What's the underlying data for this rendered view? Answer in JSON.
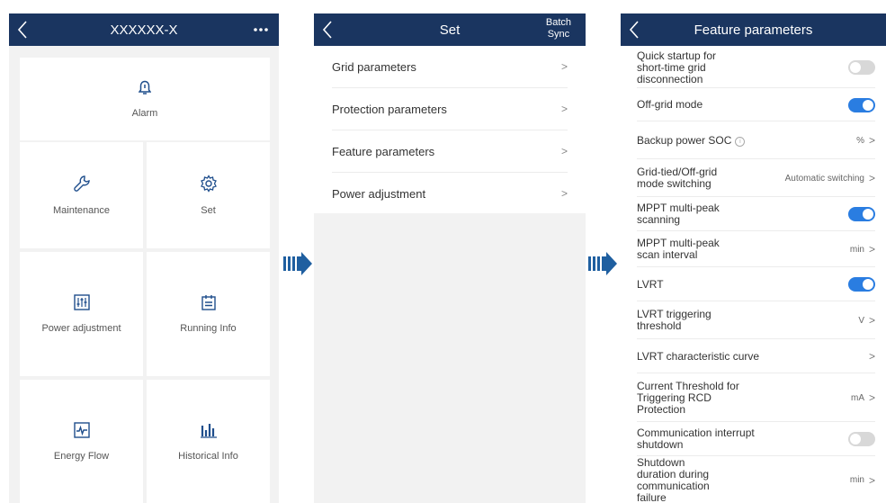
{
  "colors": {
    "header": "#1a3560",
    "toggle_on": "#2a7de1",
    "toggle_off": "#d8d8d8",
    "icon": "#1f4e8c",
    "arrow": "#1f5fa0"
  },
  "screen1": {
    "title": "XXXXXX-X",
    "menu_icon": "more-dots-icon",
    "tiles": [
      {
        "label": "Alarm",
        "icon": "bell-icon"
      },
      {
        "label": "Maintenance",
        "icon": "wrench-icon"
      },
      {
        "label": "Set",
        "icon": "gear-icon"
      },
      {
        "label": "Power adjustment",
        "icon": "sliders-icon"
      },
      {
        "label": "Running Info",
        "icon": "calendar-icon"
      },
      {
        "label": "Energy Flow",
        "icon": "pulse-icon"
      },
      {
        "label": "Historical Info",
        "icon": "bar-chart-icon"
      }
    ]
  },
  "screen2": {
    "title": "Set",
    "batch_line1": "Batch",
    "batch_line2": "Sync",
    "items": [
      {
        "label": "Grid parameters"
      },
      {
        "label": "Protection parameters"
      },
      {
        "label": "Feature parameters"
      },
      {
        "label": "Power adjustment"
      }
    ]
  },
  "screen3": {
    "title": "Feature parameters",
    "items": [
      {
        "label": "Quick startup for short-time grid disconnection",
        "toggle": "off"
      },
      {
        "label": "Off-grid mode",
        "toggle": "on"
      },
      {
        "label": "Backup power SOC",
        "value": "%",
        "info": "i"
      },
      {
        "label": "Grid-tied/Off-grid mode switching",
        "value": "Automatic switching"
      },
      {
        "label": "MPPT multi-peak scanning",
        "toggle": "on"
      },
      {
        "label": "MPPT multi-peak scan interval",
        "value": "min"
      },
      {
        "label": "LVRT",
        "toggle": "on"
      },
      {
        "label": "LVRT triggering threshold",
        "value": "V"
      },
      {
        "label": "LVRT characteristic curve",
        "value": ""
      },
      {
        "label": "Current Threshold for Triggering RCD Protection",
        "value": "mA"
      },
      {
        "label": "Communication interrupt shutdown",
        "toggle": "off"
      },
      {
        "label": "Shutdown duration during communication failure",
        "value": "min"
      }
    ]
  },
  "chevron": ">",
  "back_glyph": "<"
}
